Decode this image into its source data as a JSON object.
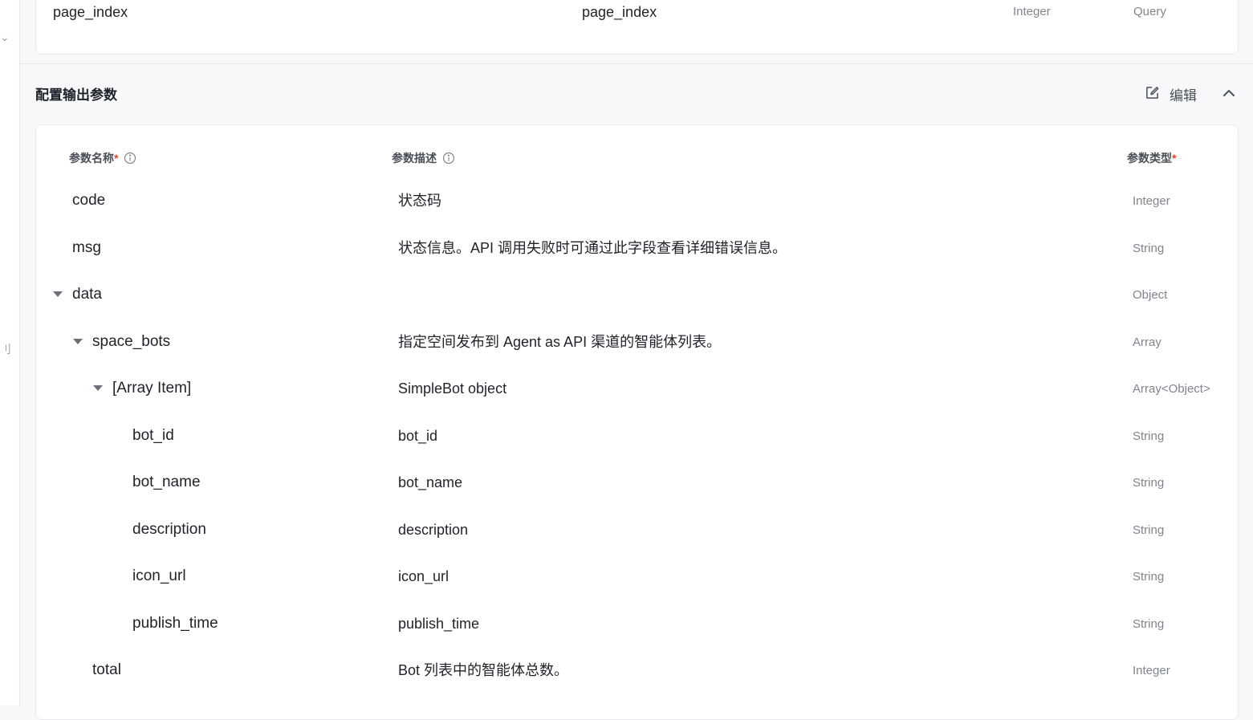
{
  "left_rail": {
    "top_glyph": "⌄",
    "mid_glyph": "刂"
  },
  "input_params": {
    "row": {
      "name": "page_index",
      "description": "page_index",
      "type": "Integer",
      "location": "Query"
    }
  },
  "output_section": {
    "title": "配置输出参数",
    "edit_label": "编辑",
    "columns": {
      "name": "参数名称",
      "description": "参数描述",
      "type": "参数类型",
      "required_mark": "*"
    },
    "rows": [
      {
        "name": "code",
        "description": "状态码",
        "type": "Integer"
      },
      {
        "name": "msg",
        "description": "状态信息。API 调用失败时可通过此字段查看详细错误信息。",
        "type": "String"
      },
      {
        "name": "data",
        "description": "",
        "type": "Object"
      },
      {
        "name": "space_bots",
        "description": "指定空间发布到 Agent as API 渠道的智能体列表。",
        "type": "Array"
      },
      {
        "name": "[Array Item]",
        "description": "SimpleBot object",
        "type": "Array<Object>"
      },
      {
        "name": "bot_id",
        "description": "bot_id",
        "type": "String"
      },
      {
        "name": "bot_name",
        "description": "bot_name",
        "type": "String"
      },
      {
        "name": "description",
        "description": "description",
        "type": "String"
      },
      {
        "name": "icon_url",
        "description": "icon_url",
        "type": "String"
      },
      {
        "name": "publish_time",
        "description": "publish_time",
        "type": "String"
      },
      {
        "name": "total",
        "description": "Bot 列表中的智能体总数。",
        "type": "Integer"
      }
    ]
  },
  "colors": {
    "required": "#e5412f",
    "muted_text": "#80858d",
    "text": "#1f2329",
    "background": "#f7f8fa"
  },
  "icons": {
    "edit": "edit-square-icon",
    "collapse": "chevron-up-icon",
    "info": "info-circle-icon",
    "expand": "caret-down-icon"
  }
}
